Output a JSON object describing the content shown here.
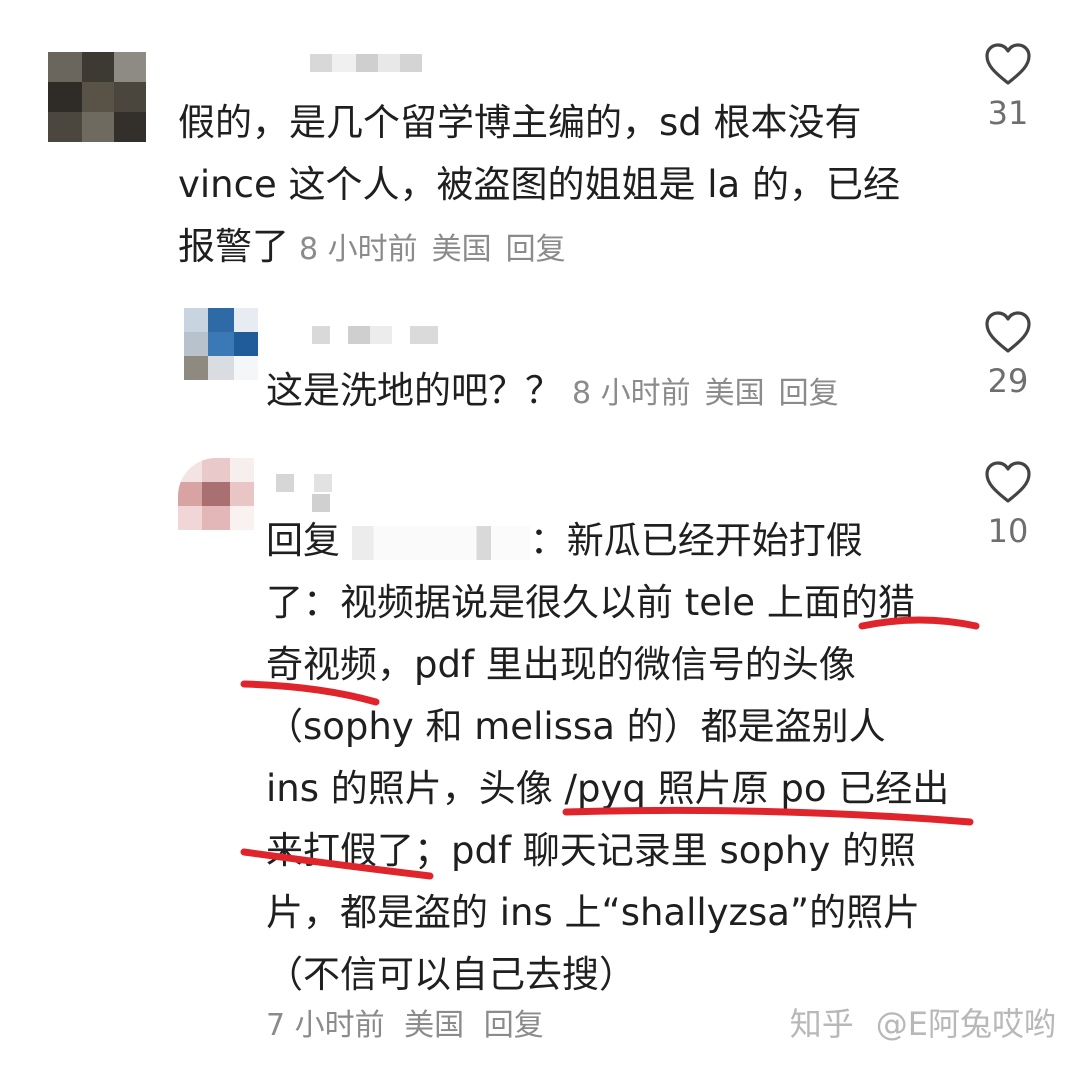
{
  "comments": [
    {
      "lines": [
        "假的，是几个留学博主编的，sd 根本没有",
        "vince 这个人，被盗图的姐姐是 la 的，已经",
        "报警了"
      ],
      "time": "8 小时前",
      "location": "美国",
      "reply": "回复",
      "likes": "31"
    },
    {
      "lines": [
        "这是洗地的吧？？"
      ],
      "time": "8 小时前",
      "location": "美国",
      "reply": "回复",
      "likes": "29"
    },
    {
      "reply_prefix": "回复",
      "first_line_tail": "：新瓜已经开始打假",
      "lines": [
        "了：视频据说是很久以前 tele 上面的猎",
        "奇视频，pdf 里出现的微信号的头像",
        "（sophy 和 melissa 的）都是盗别人",
        "ins 的照片，头像 /pyq 照片原 po 已经出",
        "来打假了；pdf 聊天记录里 sophy 的照",
        "片，都是盗的 ins 上“shallyzsa”的照片",
        "（不信可以自己去搜）"
      ],
      "time": "7 小时前",
      "location": "美国",
      "reply": "回复",
      "likes": "10"
    }
  ],
  "watermark": {
    "site": "知乎",
    "handle": "@E阿兔哎哟"
  },
  "colors": {
    "text": "#1f1f1f",
    "meta": "#8b8b8b",
    "underline": "#e0242c"
  }
}
